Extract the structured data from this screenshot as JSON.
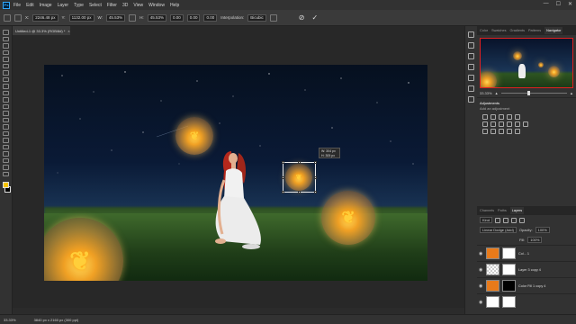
{
  "app": {
    "logo": "Ps",
    "menu": [
      "File",
      "Edit",
      "Image",
      "Layer",
      "Type",
      "Select",
      "Filter",
      "3D",
      "View",
      "Window",
      "Help"
    ],
    "window_controls": [
      "—",
      "☐",
      "✕"
    ]
  },
  "options": {
    "x_label": "X:",
    "x_value": "2246.48 px",
    "y_label": "Y:",
    "y_value": "1132.00 px",
    "w_label": "W:",
    "w_value": "45.53%",
    "h_label": "H:",
    "h_value": "45.53%",
    "angle_value": "0.00",
    "hskew_value": "0.00",
    "vskew_value": "0.00",
    "interp_label": "Interpolation:",
    "interp_value": "Bicubic",
    "commit_icon": "checkmark-icon",
    "cancel_icon": "cancel-icon"
  },
  "document": {
    "tab_label": "Untitled-1 @ 33.3% (RGB/8#) *",
    "tooltip_w": "W: 304 px",
    "tooltip_h": "H: 305 px"
  },
  "panels": {
    "top_tabs": [
      "Color",
      "Swatches",
      "Gradients",
      "Patterns",
      "Navigator"
    ],
    "active_top_tab": "Navigator",
    "zoom": "33.33%",
    "adjustments_title": "Adjustments",
    "adjustments_sub": "Add an adjustment",
    "layer_tabs": [
      "Channels",
      "Paths",
      "Layers"
    ],
    "active_layer_tab": "Layers",
    "kind_label": "Kind",
    "blend_mode": "Linear Dodge (Add)",
    "opacity_label": "Opacity:",
    "opacity_value": "100%",
    "fill_label": "Fill:",
    "fill_value": "100%",
    "layers": [
      {
        "name": "Col... 1",
        "thumb": "orange",
        "mask": "white"
      },
      {
        "name": "Layer 3 copy 4",
        "thumb": "checker",
        "mask": "white"
      },
      {
        "name": "Color Fill 1 copy 4",
        "thumb": "orange",
        "mask": "black"
      },
      {
        "name": "",
        "thumb": "white",
        "mask": "white"
      }
    ]
  },
  "status": {
    "zoom": "33.33%",
    "doc_info": "3840 px x 2160 px (300 ppi)"
  },
  "colors": {
    "foreground": "#f5c400",
    "background": "#000000",
    "accent": "#31a8ff"
  }
}
